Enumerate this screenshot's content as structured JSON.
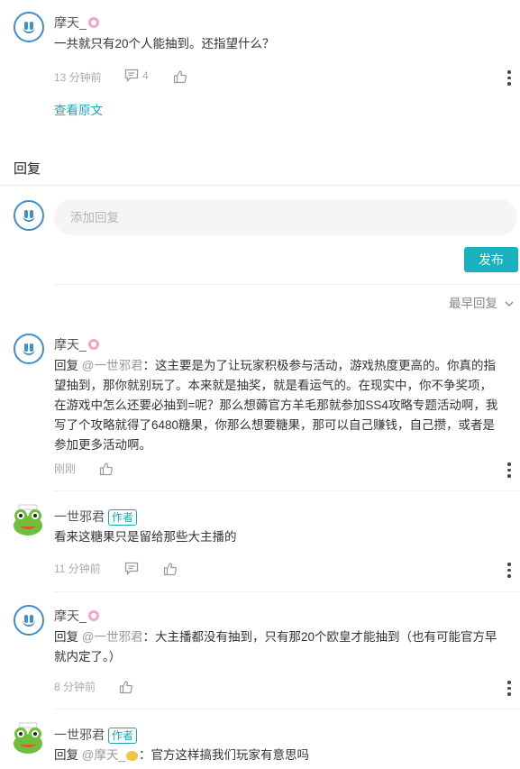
{
  "post": {
    "author": "摩天_",
    "text": "一共就只有20个人能抽到。还指望什么？",
    "time": "13 分钟前",
    "comment_count": "4",
    "view_original": "查看原文"
  },
  "reply_section": {
    "title": "回复",
    "input_placeholder": "添加回复",
    "publish_label": "发布",
    "sort_label": "最早回复"
  },
  "replies": [
    {
      "author": "摩天_",
      "prefix": "回复",
      "mention": "@一世邪君",
      "text_lines": [
        "：这主要是为了让玩家积极参与活动，游戏热度更高的。你真的指",
        "望抽到，那你就别玩了。本来就是抽奖，就是看运气的。在现实中，你不争奖项，",
        "在游戏中怎么还要必抽到=呢？那么想薅官方羊毛那就参加SS4攻略专题活动啊，我",
        "写了个攻略就得了6480糖果，你那么想要糖果，那可以自己赚钱，自己攒，或者是",
        "参加更多活动啊。"
      ],
      "time": "刚刚"
    },
    {
      "author": "一世邪君",
      "author_tag": "作者",
      "text": "看来这糖果只是留给那些大主播的",
      "time": "11 分钟前"
    },
    {
      "author": "摩天_",
      "prefix": "回复",
      "mention": "@一世邪君",
      "text_lines": [
        "：大主播都没有抽到，只有那20个欧皇才能抽到（也有可能官方早",
        "就内定了。）"
      ],
      "time": "8 分钟前"
    },
    {
      "author": "一世邪君",
      "author_tag": "作者",
      "prefix": "回复",
      "mention": "@摩天_",
      "text": "：官方这样搞我们玩家有意思吗"
    }
  ],
  "colors": {
    "accent": "#19b0bf",
    "link": "#19a7b5",
    "avatar_blue": "#3d8fd4",
    "badge_pink": "#f3a6c4"
  }
}
